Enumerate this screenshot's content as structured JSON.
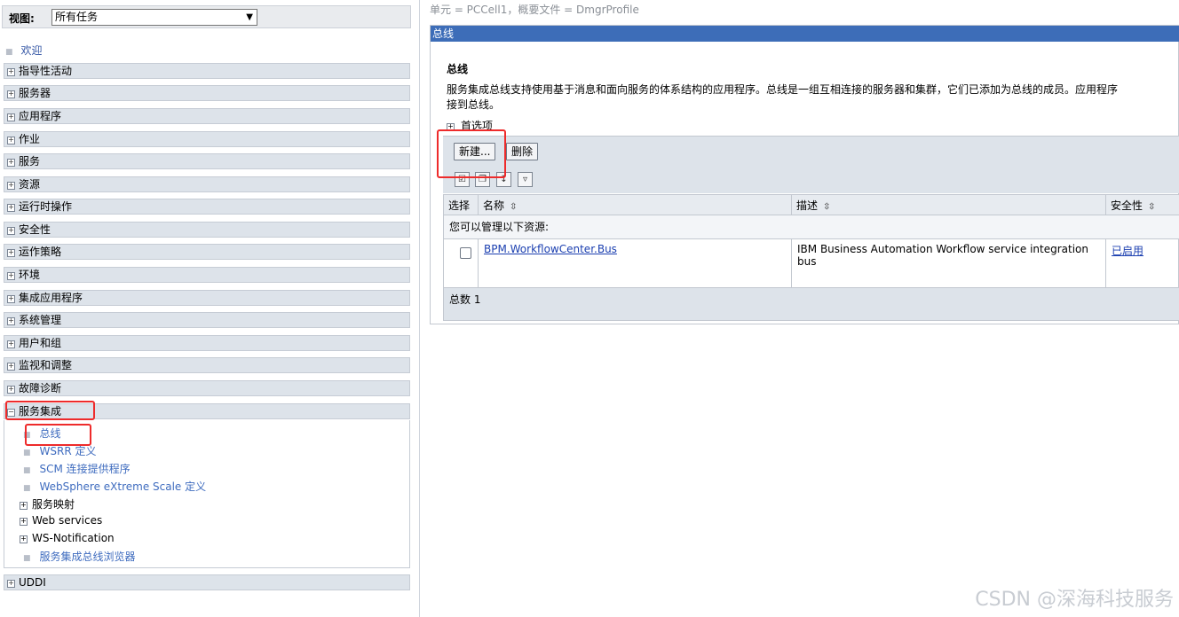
{
  "nav": {
    "view_label": "视图:",
    "view_selected": "所有任务",
    "welcome": "欢迎",
    "categories": [
      "指导性活动",
      "服务器",
      "应用程序",
      "作业",
      "服务",
      "资源",
      "运行时操作",
      "安全性",
      "运作策略",
      "环境",
      "集成应用程序",
      "系统管理",
      "用户和组",
      "监视和调整",
      "故障诊断"
    ],
    "expanded_category": "服务集成",
    "expanded_items": [
      "总线",
      "WSRR 定义",
      "SCM 连接提供程序",
      "WebSphere eXtreme Scale 定义"
    ],
    "expanded_groups": [
      "服务映射",
      "Web services",
      "WS-Notification"
    ],
    "expanded_last": "服务集成总线浏览器",
    "uddi": "UDDI"
  },
  "main": {
    "breadcrumb": "单元 = PCCell1，概要文件 = DmgrProfile",
    "panel_title": "总线",
    "section_title": "总线",
    "description": "服务集成总线支持使用基于消息和面向服务的体系结构的应用程序。总线是一组互相连接的服务器和集群，它们已添加为总线的成员。应用程序",
    "description_cont": "接到总线。",
    "preferences": "首选项",
    "new_button": "新建...",
    "delete_button": "删除",
    "columns": {
      "select": "选择",
      "name": "名称",
      "description": "描述",
      "security": "安全性"
    },
    "resources_note": "您可以管理以下资源:",
    "rows": [
      {
        "name": "BPM.WorkflowCenter.Bus",
        "description": "IBM Business Automation Workflow service integration bus",
        "security": "已启用"
      }
    ],
    "total": "总数 1"
  },
  "watermark": "CSDN @深海科技服务"
}
